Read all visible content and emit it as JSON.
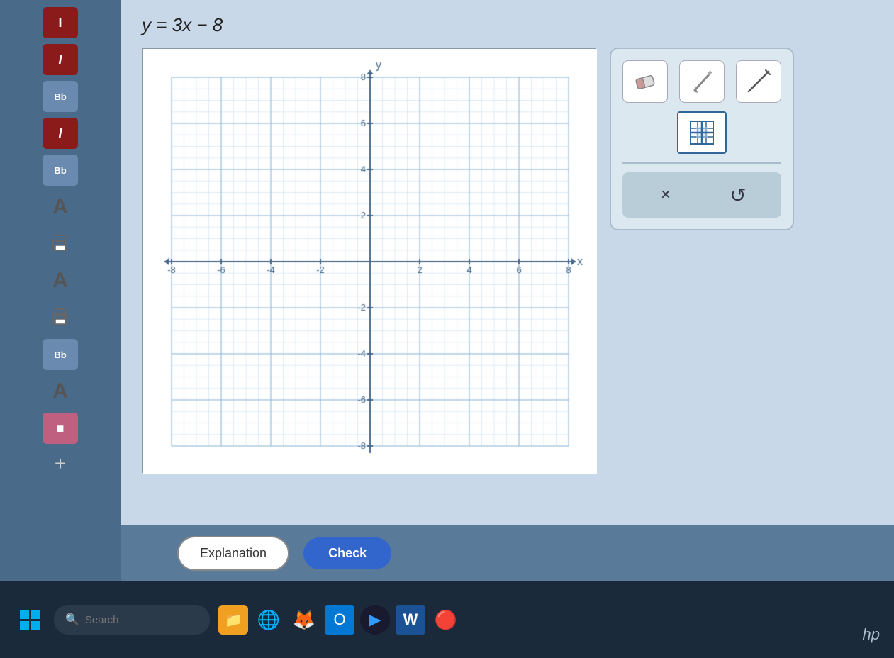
{
  "equation": {
    "text": "y = 3x − 8",
    "display": "y = 3x − 8"
  },
  "graph": {
    "x_min": -8,
    "x_max": 8,
    "y_min": -8,
    "y_max": 8,
    "x_label": "x",
    "y_label": "y",
    "grid_step": 2
  },
  "toolbar": {
    "eraser_label": "eraser",
    "pencil_label": "pencil",
    "line_label": "line tool",
    "grid_label": "grid tool",
    "clear_label": "×",
    "undo_label": "↺"
  },
  "buttons": {
    "explanation_label": "Explanation",
    "check_label": "Check"
  },
  "sidebar": {
    "items": [
      {
        "label": "I",
        "type": "red"
      },
      {
        "label": "I",
        "type": "red-italic"
      },
      {
        "label": "Bb",
        "type": "bb"
      },
      {
        "label": "I",
        "type": "red-italic"
      },
      {
        "label": "Bb",
        "type": "bb"
      },
      {
        "label": "A",
        "type": "large"
      },
      {
        "label": "🖨",
        "type": "print"
      },
      {
        "label": "A",
        "type": "large"
      },
      {
        "label": "🖨",
        "type": "print"
      },
      {
        "label": "Bb",
        "type": "bb"
      },
      {
        "label": "A",
        "type": "large"
      },
      {
        "label": "■",
        "type": "pink"
      },
      {
        "label": "+",
        "type": "plus"
      }
    ]
  },
  "taskbar": {
    "search_placeholder": "Search",
    "apps": [
      "📁",
      "🌐",
      "🦊",
      "📧",
      "▶",
      "W",
      "🔴"
    ]
  }
}
